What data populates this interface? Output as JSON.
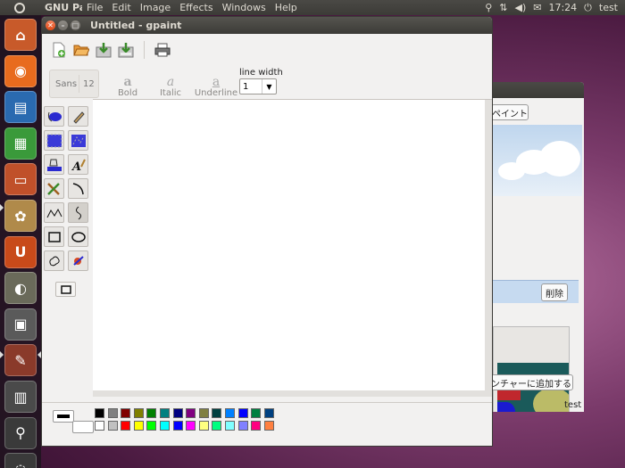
{
  "top_panel": {
    "app_name": "GNU Paint",
    "menus": [
      "File",
      "Edit",
      "Image",
      "Effects",
      "Windows",
      "Help"
    ],
    "clock": "17:24",
    "user": "test"
  },
  "launcher": {
    "items": [
      {
        "name": "home-folder",
        "color": "#c85a2a",
        "glyph": "⌂"
      },
      {
        "name": "firefox",
        "color": "#e86b1e",
        "glyph": "◉"
      },
      {
        "name": "libreoffice-writer",
        "color": "#2a6ab0",
        "glyph": "▤"
      },
      {
        "name": "libreoffice-calc",
        "color": "#3a9a3a",
        "glyph": "▦"
      },
      {
        "name": "libreoffice-impress",
        "color": "#c0502a",
        "glyph": "▭"
      },
      {
        "name": "software-center",
        "color": "#b08a4a",
        "glyph": "✿"
      },
      {
        "name": "ubuntu-one",
        "color": "#c84a1a",
        "glyph": "U"
      },
      {
        "name": "gimp",
        "color": "#6a6a5a",
        "glyph": "◐"
      },
      {
        "name": "screenshot",
        "color": "#5a5a5a",
        "glyph": "▣"
      },
      {
        "name": "gpaint",
        "color": "#8a3a2a",
        "glyph": "✎"
      },
      {
        "name": "workspaces",
        "color": "#4a4a4a",
        "glyph": "▥"
      },
      {
        "name": "search",
        "color": "#3a3a3a",
        "glyph": "⚲"
      },
      {
        "name": "trash",
        "color": "#3a3a3a",
        "glyph": "◌"
      }
    ]
  },
  "window": {
    "title": "Untitled - gpaint"
  },
  "text_toolbar": {
    "font_name": "Sans",
    "font_size": "12",
    "bold_label": "Bold",
    "italic_label": "Italic",
    "underline_label": "Underline",
    "bold_glyph": "a",
    "italic_glyph": "a",
    "underline_glyph": "a",
    "line_width_label": "line width",
    "line_width_value": "1"
  },
  "background_window": {
    "paint_button": "ペイント",
    "delete_button": "削除",
    "add_button": "ンチャーに追加する",
    "test_label": "test"
  },
  "palette": {
    "colors": [
      "#000000",
      "#808080",
      "#800000",
      "#808000",
      "#008000",
      "#008080",
      "#000080",
      "#800080",
      "#808040",
      "#004040",
      "#0080ff",
      "#0000ff",
      "#008040",
      "#004080",
      "#ffffff",
      "#c0c0c0",
      "#ff0000",
      "#ffff00",
      "#00ff00",
      "#00ffff",
      "#0000ff",
      "#ff00ff",
      "#ffff80",
      "#00ff80",
      "#80ffff",
      "#8080ff",
      "#ff0080",
      "#ff8040"
    ]
  }
}
